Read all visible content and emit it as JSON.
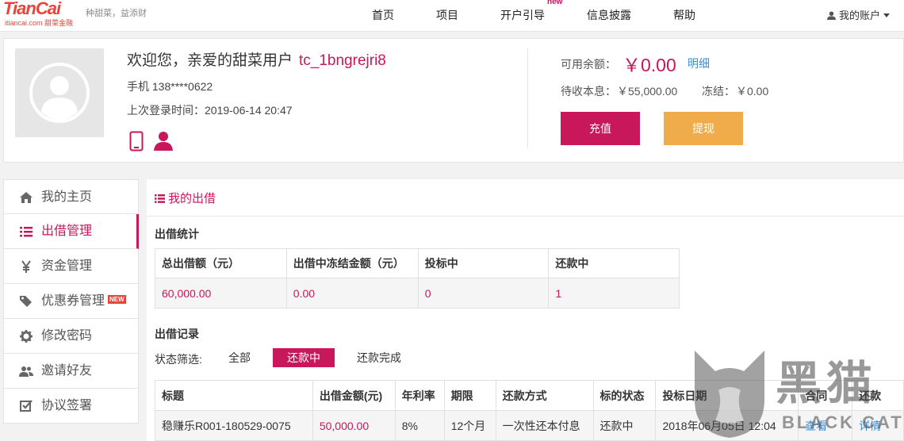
{
  "header": {
    "logo_main": "TianCai",
    "logo_sub": "itiancai.com 甜菜金融",
    "slogan": "种甜菜，益添财",
    "nav": [
      "首页",
      "项目",
      "开户引导",
      "信息披露",
      "帮助"
    ],
    "nav_new_badge": "new",
    "account_label": "我的账户"
  },
  "profile": {
    "welcome": "欢迎您，亲爱的甜菜用户",
    "username": "tc_1bngrejri8",
    "phone": "手机 138****0622",
    "last_login": "上次登录时间：2019-06-14 20:47",
    "balance_label": "可用余额：",
    "balance_value": "￥0.00",
    "detail_link": "明细",
    "pending_label": "待收本息：",
    "pending_value": "￥55,000.00",
    "frozen_label": "冻结：",
    "frozen_value": "￥0.00",
    "recharge_button": "充值",
    "withdraw_button": "提现"
  },
  "sidebar": {
    "items": [
      {
        "label": "我的主页",
        "icon": "home-icon"
      },
      {
        "label": "出借管理",
        "icon": "list-icon"
      },
      {
        "label": "资金管理",
        "icon": "yen-icon"
      },
      {
        "label": "优惠券管理",
        "icon": "tag-icon",
        "badge": "NEW"
      },
      {
        "label": "修改密码",
        "icon": "gear-icon"
      },
      {
        "label": "邀请好友",
        "icon": "users-icon"
      },
      {
        "label": "协议签署",
        "icon": "checkbox-icon"
      }
    ]
  },
  "main": {
    "title": "我的出借",
    "stats_title": "出借统计",
    "stats_headers": [
      "总出借额（元）",
      "出借中冻结金额（元）",
      "投标中",
      "还款中"
    ],
    "stats_values": [
      "60,000.00",
      "0.00",
      "0",
      "1"
    ],
    "records_title": "出借记录",
    "filter_label": "状态筛选:",
    "filters": [
      "全部",
      "还款中",
      "还款完成"
    ],
    "records_headers": [
      "标题",
      "出借金额(元)",
      "年利率",
      "期限",
      "还款方式",
      "标的状态",
      "投标日期",
      "合同",
      "还款"
    ],
    "records_rows": [
      [
        "稳赚乐R001-180529-0075",
        "50,000.00",
        "8%",
        "12个月",
        "一次性还本付息",
        "还款中",
        "2018年06月05日 12:04",
        "查看",
        "详情"
      ]
    ]
  },
  "watermark": {
    "text": "黑猫",
    "sub": "BLACK CAT"
  },
  "colors": {
    "accent": "#c8175a",
    "withdraw": "#f0ac4b",
    "link": "#3b8fd6"
  }
}
